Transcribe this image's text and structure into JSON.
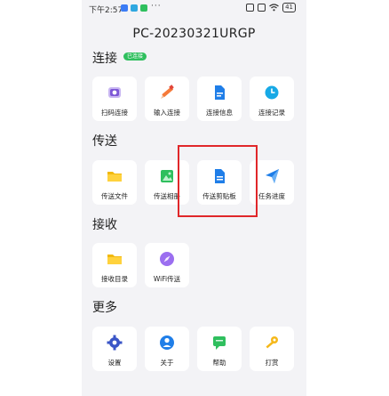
{
  "status_bar": {
    "time": "下午2:57",
    "extra": "···",
    "battery": "41"
  },
  "title": "PC-20230321URGP",
  "sections": {
    "connect": {
      "title": "连接",
      "badge": "已连接",
      "items": [
        {
          "label": "扫码连接",
          "icon": "camera-scan-icon"
        },
        {
          "label": "输入连接",
          "icon": "pencil-icon"
        },
        {
          "label": "连接信息",
          "icon": "document-icon"
        },
        {
          "label": "连接记录",
          "icon": "clock-icon"
        }
      ]
    },
    "send": {
      "title": "传送",
      "items": [
        {
          "label": "传送文件",
          "icon": "folder-icon"
        },
        {
          "label": "传送相册",
          "icon": "image-icon"
        },
        {
          "label": "传送剪贴板",
          "icon": "clipboard-icon"
        },
        {
          "label": "任务进度",
          "icon": "paper-plane-icon"
        }
      ]
    },
    "receive": {
      "title": "接收",
      "items": [
        {
          "label": "接收目录",
          "icon": "folder-icon"
        },
        {
          "label": "WiFi传送",
          "icon": "compass-icon"
        }
      ]
    },
    "more": {
      "title": "更多",
      "items": [
        {
          "label": "设置",
          "icon": "gear-icon"
        },
        {
          "label": "关于",
          "icon": "info-icon"
        },
        {
          "label": "帮助",
          "icon": "chat-icon"
        },
        {
          "label": "打赏",
          "icon": "key-icon"
        }
      ]
    }
  },
  "colors": {
    "accent_green": "#2fbf5e",
    "highlight_red": "#e0272a",
    "icon_blue": "#1f7ee8"
  }
}
